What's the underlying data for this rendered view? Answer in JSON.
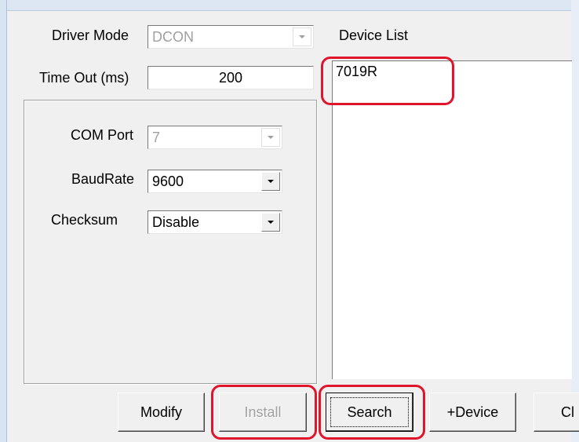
{
  "driver_mode": {
    "label": "Driver Mode",
    "value": "DCON"
  },
  "timeout": {
    "label": "Time Out (ms)",
    "value": "200"
  },
  "settings": {
    "com_port": {
      "label": "COM Port",
      "value": "7"
    },
    "baud_rate": {
      "label": "BaudRate",
      "value": "9600"
    },
    "checksum": {
      "label": "Checksum",
      "value": "Disable"
    }
  },
  "device_list": {
    "label": "Device List",
    "items": [
      "7019R"
    ]
  },
  "buttons": {
    "modify": "Modify",
    "install": "Install",
    "search": "Search",
    "add_device": "+Device",
    "clipped": "Cl"
  },
  "colors": {
    "highlight": "#e0142a",
    "background": "#f0f0f0"
  }
}
